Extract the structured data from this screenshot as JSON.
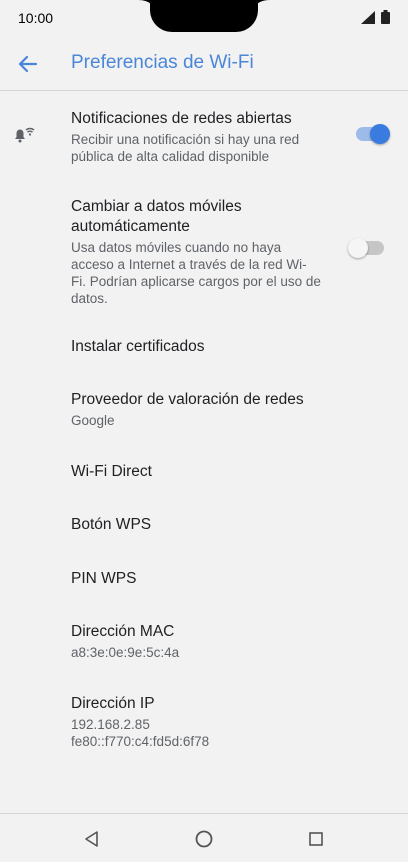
{
  "status": {
    "time": "10:00"
  },
  "header": {
    "title": "Preferencias de Wi-Fi"
  },
  "settings": [
    {
      "title": "Notificaciones de redes abiertas",
      "subtitle": "Recibir una notificación si hay una red pública de alta calidad disponible",
      "toggle": "on"
    },
    {
      "title": "Cambiar a datos móviles automáticamente",
      "subtitle": "Usa datos móviles cuando no haya acceso a Internet a través de la red Wi-Fi. Podrían aplicarse cargos por el uso de datos.",
      "toggle": "off"
    },
    {
      "title": "Instalar certificados"
    },
    {
      "title": "Proveedor de valoración de redes",
      "subtitle": "Google"
    },
    {
      "title": "Wi-Fi Direct"
    },
    {
      "title": "Botón WPS"
    },
    {
      "title": "PIN WPS"
    },
    {
      "title": "Dirección MAC",
      "subtitle": "a8:3e:0e:9e:5c:4a"
    },
    {
      "title": "Dirección IP",
      "subtitle": "192.168.2.85\nfe80::f770:c4:fd5d:6f78"
    }
  ],
  "colors": {
    "accent": "#4a86d8",
    "toggle_on_track": "#9dbbe9",
    "toggle_on_knob": "#3a7be0",
    "toggle_off_track": "#c6c6c6",
    "toggle_off_knob": "#f5f5f5"
  },
  "icons": [
    "back-arrow-icon",
    "wifi-notification-bell-icon",
    "signal-icon",
    "battery-icon",
    "nav-back-icon",
    "nav-home-icon",
    "nav-recents-icon"
  ]
}
